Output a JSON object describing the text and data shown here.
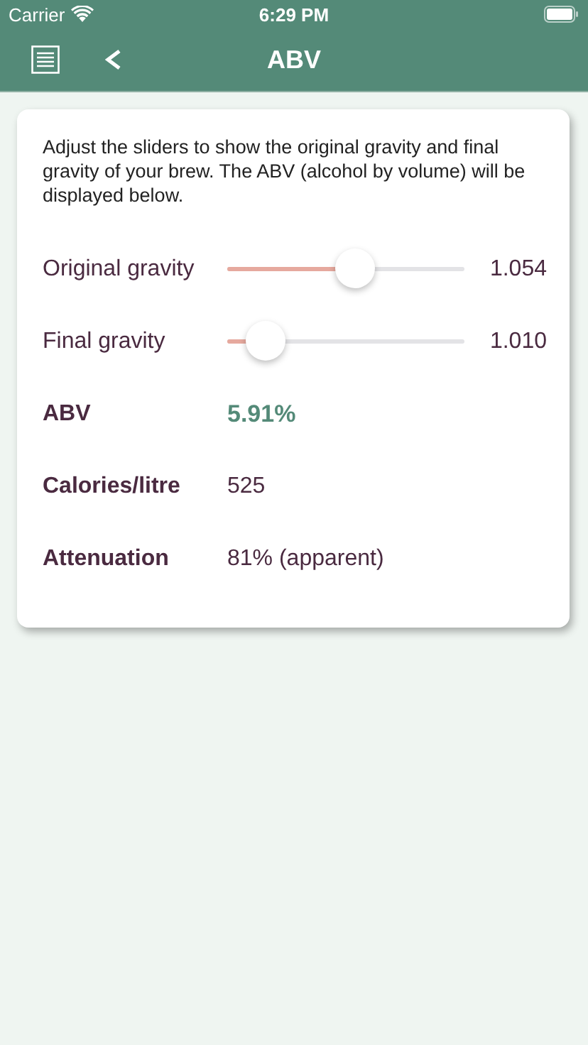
{
  "status_bar": {
    "carrier": "Carrier",
    "time": "6:29 PM"
  },
  "nav_bar": {
    "title": "ABV"
  },
  "intro": "Adjust the sliders to show the original gravity and final gravity of your brew. The ABV (alcohol by volume) will be displayed below.",
  "sliders": [
    {
      "label": "Original gravity",
      "level": 0.54,
      "reading": "1.054"
    },
    {
      "label": "Final gravity",
      "level": 0.16,
      "reading": "1.010"
    }
  ],
  "results": [
    {
      "label": "ABV",
      "value": "5.91%",
      "kind": "highlight"
    },
    {
      "label": "Calories/litre",
      "value": "525",
      "kind": "plain"
    },
    {
      "label": "Attenuation",
      "value": "81% (apparent)",
      "kind": "plain"
    }
  ]
}
